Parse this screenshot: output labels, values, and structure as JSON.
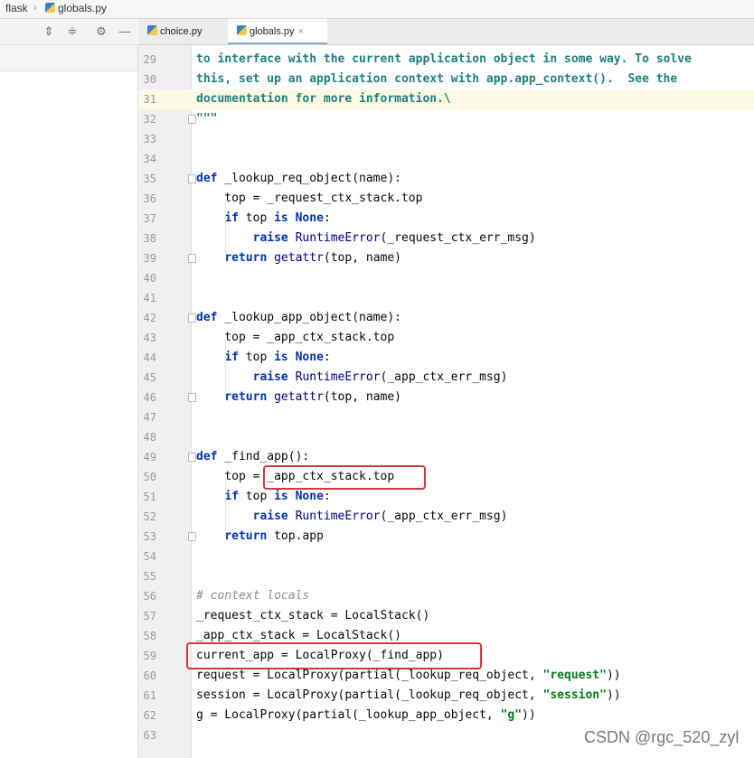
{
  "breadcrumb": {
    "project": "flask",
    "file": "globals.py"
  },
  "toolbar": {
    "icons": [
      "expand-all-icon",
      "collapse-all-icon",
      "gear-icon",
      "minimize-icon"
    ]
  },
  "tabs": [
    {
      "label": "choice.py",
      "active": false
    },
    {
      "label": "globals.py",
      "active": true,
      "close": "×"
    }
  ],
  "editor": {
    "current_line": 31,
    "lines": [
      {
        "n": "29",
        "html": "<span class=\"doc\">to interface with the current application object in some way. To solve</span>"
      },
      {
        "n": "30",
        "html": "<span class=\"doc\">this, set up an application context with app.app_context().  See the</span>"
      },
      {
        "n": "31",
        "html": "<span class=\"doc\">documentation for more information.\\</span>"
      },
      {
        "n": "32",
        "html": "<span class=\"doc\">\"\"\"</span>"
      },
      {
        "n": "33",
        "html": ""
      },
      {
        "n": "34",
        "html": ""
      },
      {
        "n": "35",
        "html": "<span class=\"kw\">def</span> _lookup_req_object(name):"
      },
      {
        "n": "36",
        "html": "    top = _request_ctx_stack.top"
      },
      {
        "n": "37",
        "html": "    <span class=\"kw\">if</span> top <span class=\"kw\">is</span> <span class=\"kw\">None</span>:"
      },
      {
        "n": "38",
        "html": "        <span class=\"kw\">raise</span> <span class=\"bi\">RuntimeError</span>(_request_ctx_err_msg)"
      },
      {
        "n": "39",
        "html": "    <span class=\"kw\">return</span> <span class=\"bi\">getattr</span>(top, name)"
      },
      {
        "n": "40",
        "html": ""
      },
      {
        "n": "41",
        "html": ""
      },
      {
        "n": "42",
        "html": "<span class=\"kw\">def</span> _lookup_app_object(name):"
      },
      {
        "n": "43",
        "html": "    top = _app_ctx_stack.top"
      },
      {
        "n": "44",
        "html": "    <span class=\"kw\">if</span> top <span class=\"kw\">is</span> <span class=\"kw\">None</span>:"
      },
      {
        "n": "45",
        "html": "        <span class=\"kw\">raise</span> <span class=\"bi\">RuntimeError</span>(_app_ctx_err_msg)"
      },
      {
        "n": "46",
        "html": "    <span class=\"kw\">return</span> <span class=\"bi\">getattr</span>(top, name)"
      },
      {
        "n": "47",
        "html": ""
      },
      {
        "n": "48",
        "html": ""
      },
      {
        "n": "49",
        "html": "<span class=\"kw\">def</span> _find_app():"
      },
      {
        "n": "50",
        "html": "    top = _app_ctx_stack.top"
      },
      {
        "n": "51",
        "html": "    <span class=\"kw\">if</span> top <span class=\"kw\">is</span> <span class=\"kw\">None</span>:"
      },
      {
        "n": "52",
        "html": "        <span class=\"kw\">raise</span> <span class=\"bi\">RuntimeError</span>(_app_ctx_err_msg)"
      },
      {
        "n": "53",
        "html": "    <span class=\"kw\">return</span> top.app"
      },
      {
        "n": "54",
        "html": ""
      },
      {
        "n": "55",
        "html": ""
      },
      {
        "n": "56",
        "html": "<span class=\"cm\"># context locals</span>"
      },
      {
        "n": "57",
        "html": "_request_ctx_stack = LocalStack()"
      },
      {
        "n": "58",
        "html": "_app_ctx_stack = LocalStack()"
      },
      {
        "n": "59",
        "html": "current_app = LocalProxy(_find_app)"
      },
      {
        "n": "60",
        "html": "request = LocalProxy(partial(_lookup_req_object, <span class=\"str\">\"request\"</span>))"
      },
      {
        "n": "61",
        "html": "session = LocalProxy(partial(_lookup_req_object, <span class=\"str\">\"session\"</span>))"
      },
      {
        "n": "62",
        "html": "g = LocalProxy(partial(_lookup_app_object, <span class=\"str\">\"g\"</span>))"
      },
      {
        "n": "63",
        "html": ""
      }
    ]
  },
  "colors": {
    "keyword": "#0033b3",
    "string": "#067d17",
    "docstring": "#1f7e7e",
    "comment": "#8c8c8c",
    "highlight_box": "#d03a3a",
    "current_line": "#fcfae7"
  },
  "watermark": "CSDN @rgc_520_zyl"
}
